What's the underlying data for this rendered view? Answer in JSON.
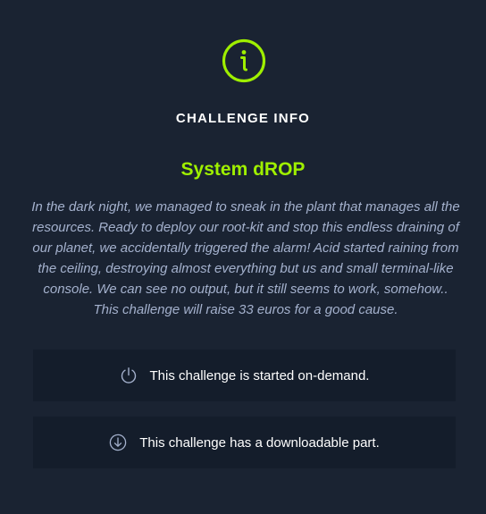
{
  "header": {
    "icon": "info-circle-icon",
    "title": "CHALLENGE INFO"
  },
  "challenge": {
    "name": "System dROP",
    "description_lines": [
      "In the dark night, we managed to sneak in the plant that manages all the",
      "resources. Ready to deploy our root-kit and stop this endless draining of",
      "our planet, we accidentally triggered the alarm! Acid started raining from",
      "the ceiling, destroying almost everything but us and small terminal-like",
      "console. We can see no output, but it still seems to work, somehow..",
      "This challenge will raise 33 euros for a good cause."
    ]
  },
  "features": [
    {
      "icon": "power-icon",
      "text": "This challenge is started on-demand."
    },
    {
      "icon": "download-icon",
      "text": "This challenge has a downloadable part."
    }
  ],
  "colors": {
    "background": "#1a2332",
    "box_background": "#141d2b",
    "accent": "#9fef00",
    "text_muted": "#a4b1cd",
    "text_primary": "#ffffff"
  }
}
